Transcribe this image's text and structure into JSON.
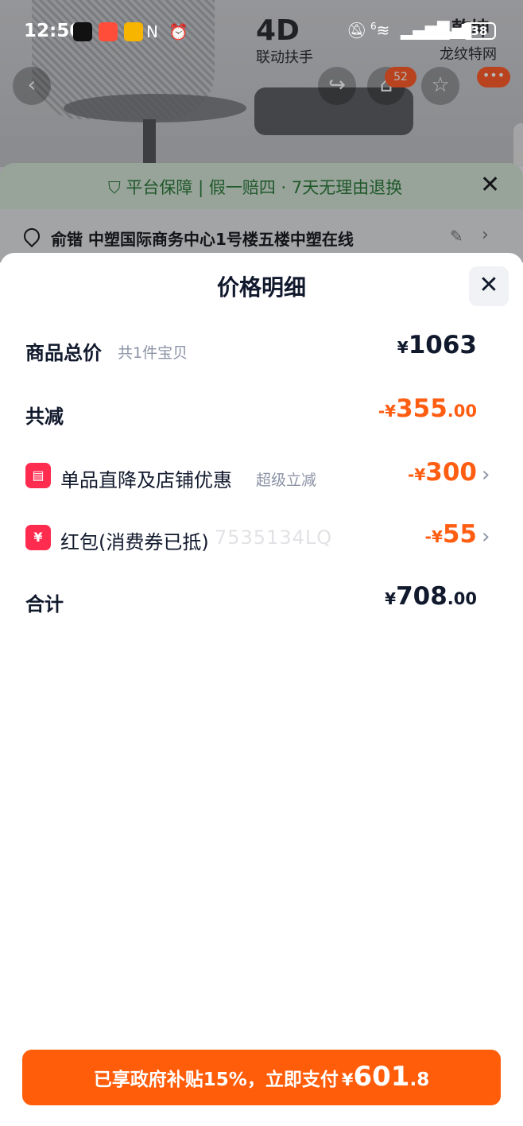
{
  "status_bar": {
    "time": "12:50",
    "battery": "38",
    "network_label": "6"
  },
  "background": {
    "promo_4d": "4D",
    "promo_4d_sub": "联动扶手",
    "promo_right_1": "乾坤",
    "promo_right_2": "龙纹特网",
    "cart_count": "52",
    "more_badge": "•••",
    "guarantee_text": "平台保障 | 假一赔四 · 7天无理由退换",
    "address": "俞锴 中塑国际商务中心1号楼五楼中塑在线"
  },
  "sheet": {
    "title": "价格明细",
    "rows": [
      {
        "label": "商品总价",
        "sub": "共1件宝贝",
        "currency": "¥",
        "amount": "1063",
        "decimal": ""
      },
      {
        "label": "共减",
        "sub": "",
        "prefix": "-",
        "currency": "¥",
        "amount": "355",
        "decimal": ".00"
      },
      {
        "label": "单品直降及店铺优惠",
        "sub": "超级立减",
        "prefix": "-",
        "currency": "¥",
        "amount": "300",
        "decimal": "",
        "icon": "store-icon"
      },
      {
        "label": "红包(消费券已抵)",
        "sub": "",
        "prefix": "-",
        "currency": "¥",
        "amount": "55",
        "decimal": "",
        "icon": "red-packet-icon",
        "watermark": "7535134LQ"
      },
      {
        "label": "合计",
        "sub": "",
        "currency": "¥",
        "amount": "708",
        "decimal": ".00"
      }
    ]
  },
  "pay_button": {
    "text": "已享政府补贴15%，立即支付",
    "currency": "¥",
    "amount": "601",
    "decimal": ".8"
  },
  "colors": {
    "accent_orange": "#ff5d12",
    "pay_button": "#ff5d0a",
    "icon_red": "#ff2c50",
    "guarantee_green": "#2c7a3b"
  }
}
